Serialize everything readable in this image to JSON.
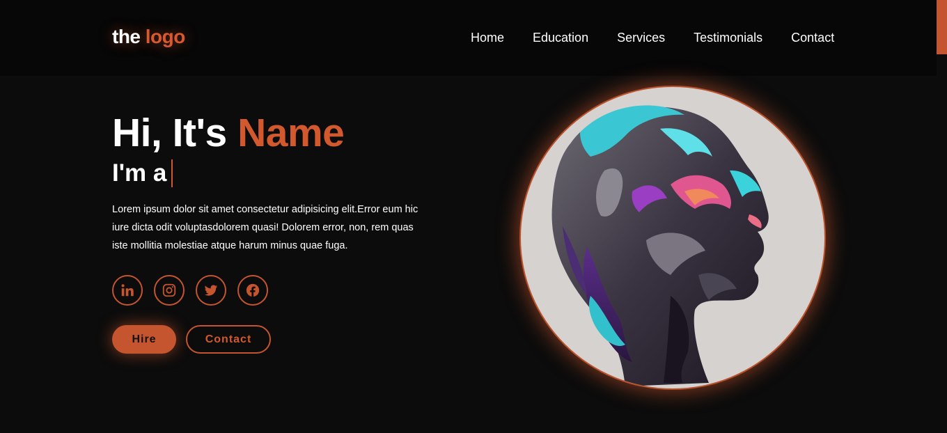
{
  "header": {
    "logo_prefix": "the",
    "logo_accent": "logo",
    "nav": [
      "Home",
      "Education",
      "Services",
      "Testimonials",
      "Contact"
    ]
  },
  "hero": {
    "title_prefix": "Hi, It's",
    "title_accent": "Name",
    "subtitle": "I'm a",
    "description": "Lorem ipsum dolor sit amet consectetur adipisicing elit.Error eum hic iure dicta odit voluptasdolorem quasi! Dolorem error, non, rem quas iste mollitia molestiae atque harum minus quae fuga.",
    "socials": [
      "linkedin-icon",
      "instagram-icon",
      "twitter-icon",
      "facebook-icon"
    ],
    "buttons": {
      "hire": "Hire",
      "contact": "Contact"
    }
  },
  "colors": {
    "accent": "#d2592d",
    "background": "#0c0c0c",
    "navbar": "#070707",
    "portrait_background": "#d6d2cf"
  }
}
